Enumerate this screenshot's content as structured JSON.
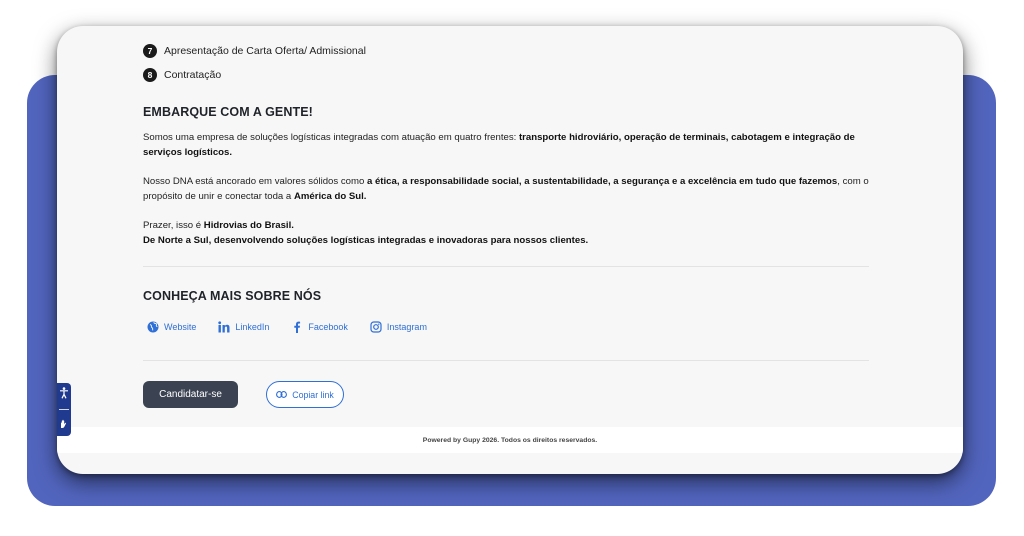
{
  "steps": [
    {
      "number": "7",
      "label": "Apresentação de Carta Oferta/ Admissional"
    },
    {
      "number": "8",
      "label": "Contratação"
    }
  ],
  "about": {
    "heading": "EMBARQUE COM A GENTE!",
    "p1_prefix": "Somos uma empresa de soluções logísticas integradas com atuação em quatro frentes: ",
    "p1_bold": "transporte hidroviário, operação de terminais, cabotagem e integração de serviços logísticos.",
    "p2_prefix": "Nosso DNA está ancorado em valores sólidos como ",
    "p2_bold": "a ética, a responsabilidade social, a sustentabilidade, a segurança e a excelência em tudo que fazemos",
    "p2_mid": ", com o propósito de unir e conectar toda a ",
    "p2_bold2": "América do Sul.",
    "p3_prefix": "Prazer, isso é ",
    "p3_bold": "Hidrovias do Brasil.",
    "p3_line2": "De Norte a Sul, desenvolvendo soluções logísticas integradas e inovadoras para nossos clientes."
  },
  "social": {
    "heading": "CONHEÇA MAIS SOBRE NÓS",
    "links": [
      {
        "icon": "globe-icon",
        "label": "Website"
      },
      {
        "icon": "linkedin-icon",
        "label": "LinkedIn"
      },
      {
        "icon": "facebook-icon",
        "label": "Facebook"
      },
      {
        "icon": "instagram-icon",
        "label": "Instagram"
      }
    ]
  },
  "actions": {
    "apply_label": "Candidatar-se",
    "copy_label": "Copiar link"
  },
  "footer": {
    "text": "Powered by Gupy 2026. Todos os direitos reservados."
  },
  "colors": {
    "accent": "#2f6fd6",
    "background_panel": "#5265be",
    "button_dark": "#3b4352"
  }
}
